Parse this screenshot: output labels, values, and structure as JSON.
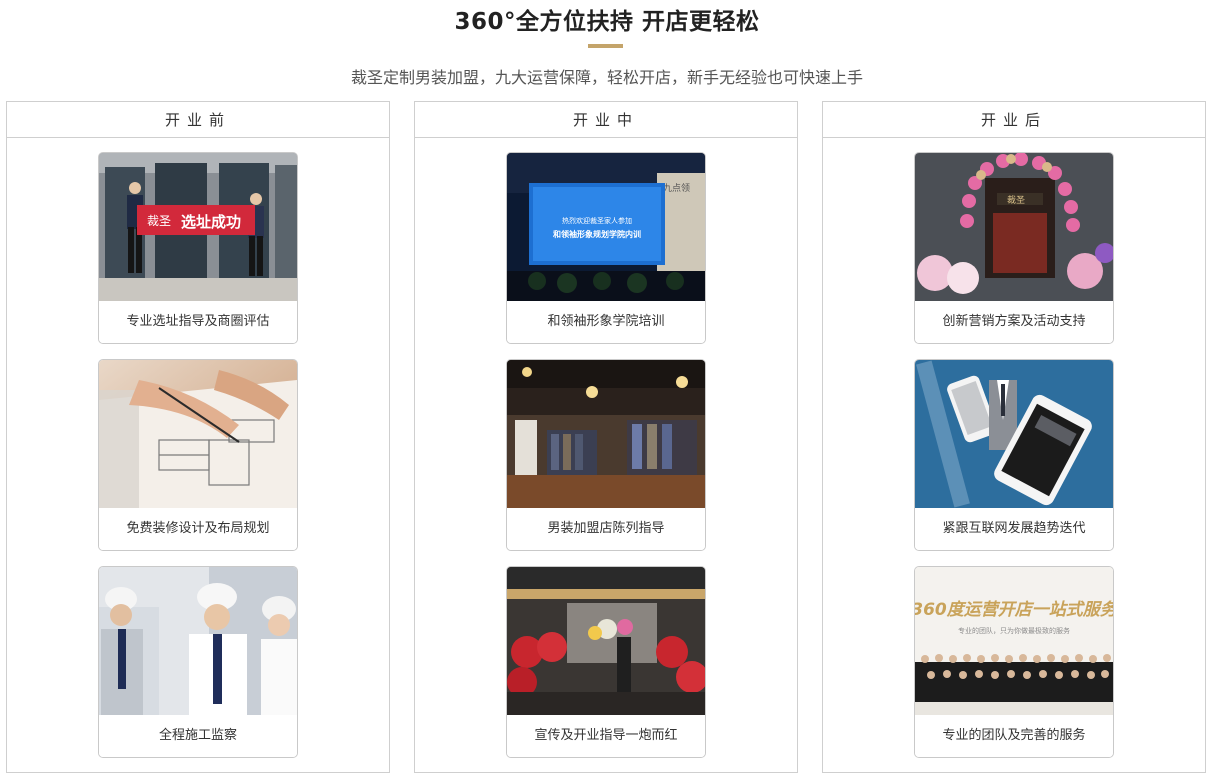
{
  "header": {
    "title": "360°全方位扶持 开店更轻松",
    "subtitle": "裁圣定制男装加盟，九大运营保障，轻松开店，新手无经验也可快速上手",
    "accent_color": "#c4a46a"
  },
  "columns": [
    {
      "title": "开业前",
      "cards": [
        {
          "caption": "专业选址指导及商圈评估",
          "banner_left": "裁圣",
          "banner_right": "选址成功"
        },
        {
          "caption": "免费装修设计及布局规划"
        },
        {
          "caption": "全程施工监察"
        }
      ]
    },
    {
      "title": "开业中",
      "cards": [
        {
          "caption": "和领袖形象学院培训",
          "screen_line1": "热烈欢迎裁圣家人参加",
          "screen_line2": "和领袖形象规划学院内训",
          "wall_text": "九点领"
        },
        {
          "caption": "男装加盟店陈列指导"
        },
        {
          "caption": "宣传及开业指导一炮而红"
        }
      ]
    },
    {
      "title": "开业后",
      "cards": [
        {
          "caption": "创新营销方案及活动支持",
          "sign_text": "裁圣"
        },
        {
          "caption": "紧跟互联网发展趋势迭代"
        },
        {
          "caption": "专业的团队及完善的服务",
          "promo_headline": "360度运营开店一站式服务",
          "promo_sub": "专业的团队，只为你做最极致的服务"
        }
      ]
    }
  ]
}
